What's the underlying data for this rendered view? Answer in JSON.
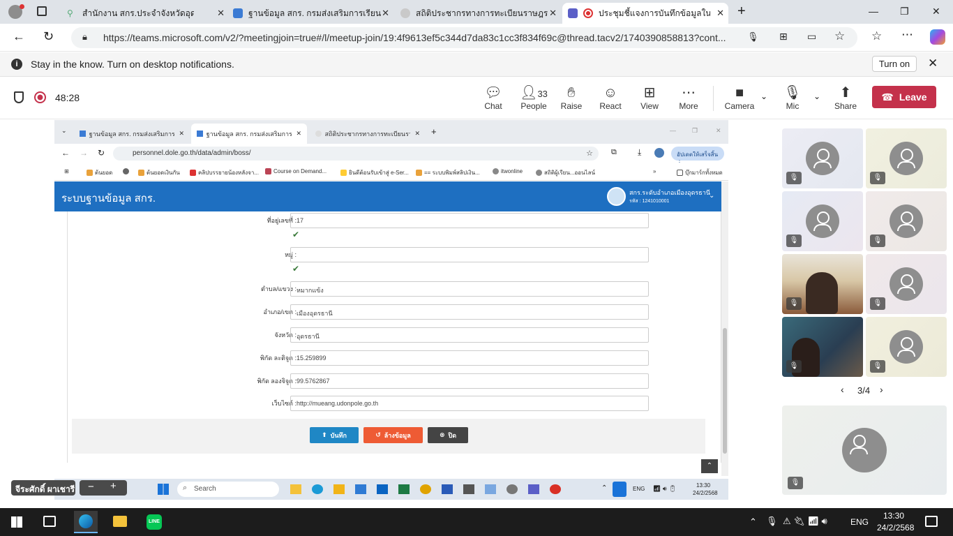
{
  "browser": {
    "tabs": [
      {
        "title": "สำนักงาน สกร.ประจำจังหวัดอุดรธานี - ร"
      },
      {
        "title": "ฐานข้อมูล สกร. กรมส่งเสริมการเรียนรู้"
      },
      {
        "title": "สถิติประชากรทางการทะเบียนราษฎร"
      },
      {
        "title": "ประชุมชี้แจงการบันทึกข้อมูลในระบ"
      }
    ],
    "url": "https://teams.microsoft.com/v2/?meetingjoin=true#/l/meetup-join/19:4f9613ef5c344d7da83c1cc3f834f69c@thread.tacv2/1740390858813?cont...",
    "notification": {
      "text": "Stay in the know. Turn on desktop notifications.",
      "button": "Turn on"
    }
  },
  "teams": {
    "timer": "48:28",
    "people_count": "33",
    "controls": {
      "chat": "Chat",
      "people": "People",
      "raise": "Raise",
      "react": "React",
      "view": "View",
      "more": "More",
      "camera": "Camera",
      "mic": "Mic",
      "share": "Share",
      "leave": "Leave"
    },
    "pagination": "3/4"
  },
  "shared": {
    "tabs": [
      {
        "title": "ฐานข้อมูล สกร. กรมส่งเสริมการเรียน"
      },
      {
        "title": "ฐานข้อมูล สกร. กรมส่งเสริมการเรียน"
      },
      {
        "title": "สถิติประชากรทางการทะเบียนราษฎร"
      }
    ],
    "url": "personnel.dole.go.th/data/admin/boss/",
    "update_btn": "อัปเดตให้เสร็จสิ้น",
    "bookmarks": [
      "ต้นยอด",
      "ต้นยอดเงินกัน",
      "คลิปบรรยายน้องหลังจา...",
      "Course on Demand...",
      "ยินดีต้อนรับเข้าสู่ e-Ser...",
      "== ระบบพิมพ์สลิปเงิน...",
      "itwonline",
      "สถิติผู้เรียน...ออนไลน์",
      "บุ๊กมาร์กทั้งหมด"
    ],
    "app_title": "ระบบฐานข้อมูล สกร.",
    "user": {
      "name": "สกร.ระดับอำเภอเมืองอุดรธานี",
      "code": "รหัส : 1241010001"
    },
    "form": [
      {
        "label": "ที่อยู่เลขที่ :",
        "value": "17"
      },
      {
        "label": "หมู่ :",
        "value": ""
      },
      {
        "label": "ตำบล/แขวง :",
        "value": "หมากแข้ง"
      },
      {
        "label": "อำเภอ/เขต :",
        "value": "เมืองอุดรธานี"
      },
      {
        "label": "จังหวัด :",
        "value": "อุดรธานี"
      },
      {
        "label": "พิกัด ละติจูด :",
        "value": "15.259899"
      },
      {
        "label": "พิกัด ลองจิจูด :",
        "value": "99.5762867"
      },
      {
        "label": "เว็บไซต์ :",
        "value": "http://mueang.udonpole.go.th"
      }
    ],
    "buttons": {
      "save": "บันทึก",
      "reset": "ล้างข้อมูล",
      "close": "ปิด"
    },
    "taskbar": {
      "presenter": "จีระศักดิ์ ผาเชารี",
      "search": "Search",
      "lang": "ENG",
      "time": "13:30",
      "date": "24/2/2568"
    }
  },
  "windows": {
    "lang": "ENG",
    "time": "13:30",
    "date": "24/2/2568"
  }
}
